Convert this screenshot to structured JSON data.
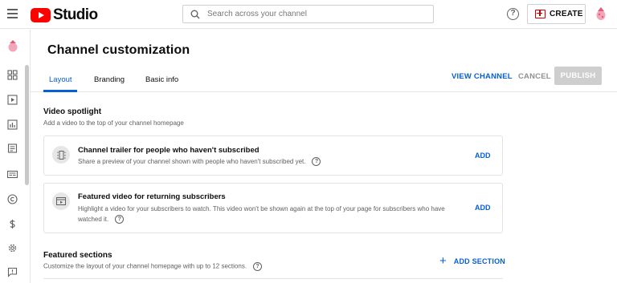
{
  "header": {
    "logo_text": "Studio",
    "search_placeholder": "Search across your channel",
    "help_glyph": "?",
    "create_label": "CREATE"
  },
  "icons": {
    "menu": "hamburger-menu-icon",
    "search": "search-icon",
    "help": "help-icon",
    "create": "video-camera-plus-icon",
    "account": "avatar-icon",
    "nav": [
      "dashboard-icon",
      "content-icon",
      "analytics-icon",
      "comments-icon",
      "subtitles-icon",
      "copyright-icon",
      "monetization-icon",
      "settings-icon",
      "feedback-icon"
    ]
  },
  "page": {
    "title": "Channel customization",
    "tabs": [
      {
        "label": "Layout",
        "active": true
      },
      {
        "label": "Branding",
        "active": false
      },
      {
        "label": "Basic info",
        "active": false
      }
    ],
    "actions": {
      "view_channel": "VIEW CHANNEL",
      "cancel": "CANCEL",
      "publish": "PUBLISH"
    }
  },
  "video_spotlight": {
    "title": "Video spotlight",
    "description": "Add a video to the top of your channel homepage",
    "cards": [
      {
        "title": "Channel trailer for people who haven't subscribed",
        "description": "Share a preview of your channel shown with people who haven't subscribed yet.",
        "action": "ADD"
      },
      {
        "title": "Featured video for returning subscribers",
        "description_line1": "Highlight a video for your subscribers to watch. This video won't be shown again at the top of your page for subscribers who have",
        "description_line2": "watched it.",
        "action": "ADD"
      }
    ]
  },
  "featured_sections": {
    "title": "Featured sections",
    "description": "Customize the layout of your channel homepage with up to 12 sections.",
    "add_section": "ADD SECTION",
    "add_glyph": "+"
  },
  "colors": {
    "accent": "#065fd4",
    "brand_red": "#ff0000",
    "disabled": "#cecece"
  }
}
